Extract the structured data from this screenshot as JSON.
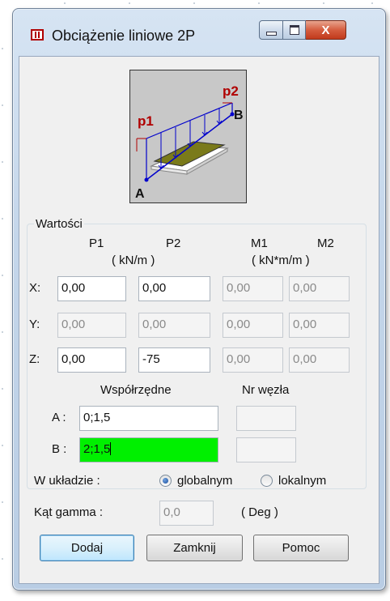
{
  "window": {
    "title": "Obciążenie liniowe 2P",
    "close_glyph": "X"
  },
  "diagram": {
    "label_p1": "p1",
    "label_p2": "p2",
    "label_a": "A",
    "label_b": "B",
    "colors": {
      "background": "#c8c8c8",
      "plate": "#7a7a1a",
      "load": "#0000cc",
      "p_label": "#b00000"
    }
  },
  "values": {
    "legend": "Wartości",
    "headers": {
      "p1": "P1",
      "p2": "P2",
      "m1": "M1",
      "m2": "M2"
    },
    "units": {
      "force": "( kN/m )",
      "moment": "( kN*m/m )"
    },
    "rows": [
      {
        "axis": "X:",
        "p1": "0,00",
        "p2": "0,00",
        "m1": "0,00",
        "m2": "0,00"
      },
      {
        "axis": "Y:",
        "p1": "0,00",
        "p2": "0,00",
        "m1": "0,00",
        "m2": "0,00"
      },
      {
        "axis": "Z:",
        "p1": "0,00",
        "p2": "-75",
        "m1": "0,00",
        "m2": "0,00"
      }
    ],
    "coords_header": "Współrzędne",
    "node_header": "Nr węzła",
    "point_a_label": "A :",
    "point_a_value": "0;1,5",
    "point_b_label": "B :",
    "point_b_value": "2;1,5",
    "system_label": "W układzie :",
    "radio_global": "globalnym",
    "radio_local": "lokalnym",
    "selected_system": "globalnym",
    "gamma_label": "Kąt gamma :",
    "gamma_value": "0,0",
    "gamma_unit": "( Deg )"
  },
  "buttons": {
    "add": "Dodaj",
    "close": "Zamknij",
    "help": "Pomoc"
  }
}
